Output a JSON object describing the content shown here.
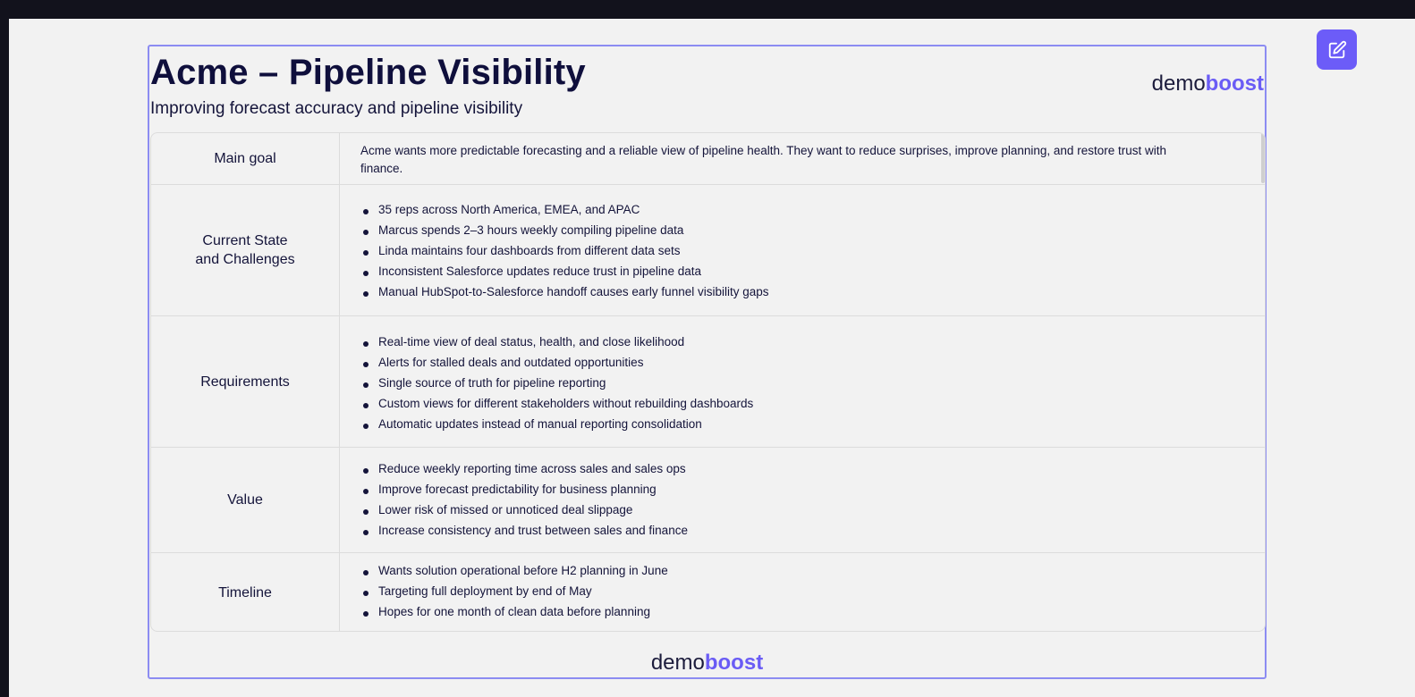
{
  "header": {
    "title": "Acme – Pipeline Visibility",
    "subtitle": "Improving forecast accuracy and pipeline visibility"
  },
  "brand": {
    "demo": "demo",
    "boost": "boost"
  },
  "colors": {
    "accent": "#6a5cf5",
    "card_border": "#8c8cf2",
    "text": "#14143a",
    "background": "#f2f2f2"
  },
  "icons": {
    "edit": "edit-pencil-icon"
  },
  "rows": {
    "main_goal": {
      "label": "Main goal",
      "text": "Acme wants more predictable forecasting and a reliable view of pipeline health. They want to reduce surprises, improve planning, and restore trust with finance."
    },
    "current_state": {
      "label": "Current State\nand Challenges",
      "items": [
        "35 reps across North America, EMEA, and APAC",
        "Marcus spends 2–3 hours weekly compiling pipeline data",
        "Linda maintains four dashboards from different data sets",
        "Inconsistent Salesforce updates reduce trust in pipeline data",
        "Manual HubSpot-to-Salesforce handoff causes early funnel visibility gaps"
      ]
    },
    "requirements": {
      "label": "Requirements",
      "items": [
        "Real-time view of deal status, health, and close likelihood",
        "Alerts for stalled deals and outdated opportunities",
        "Single source of truth for pipeline reporting",
        "Custom views for different stakeholders without rebuilding dashboards",
        "Automatic updates instead of manual reporting consolidation"
      ]
    },
    "value": {
      "label": "Value",
      "items": [
        "Reduce weekly reporting time across sales and sales ops",
        "Improve forecast predictability for business planning",
        "Lower risk of missed or unnoticed deal slippage",
        "Increase consistency and trust between sales and finance"
      ]
    },
    "timeline": {
      "label": "Timeline",
      "items": [
        "Wants solution operational before H2 planning in June",
        "Targeting full deployment by end of May",
        "Hopes for one month of clean data before planning"
      ]
    }
  }
}
